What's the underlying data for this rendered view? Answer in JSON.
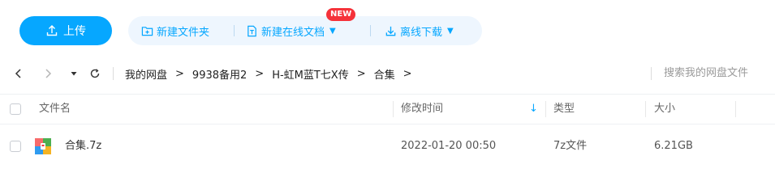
{
  "toolbar": {
    "upload_label": "上传",
    "new_folder_label": "新建文件夹",
    "new_online_doc_label": "新建在线文档",
    "new_badge": "NEW",
    "offline_download_label": "离线下载"
  },
  "navbar": {
    "breadcrumbs": [
      "我的网盘",
      "9938备用2",
      "H-虹M蓝T七X传",
      "合集"
    ],
    "search_placeholder": "搜索我的网盘文件"
  },
  "table": {
    "columns": {
      "name": "文件名",
      "modified": "修改时间",
      "type": "类型",
      "size": "大小"
    },
    "sort_indicator": "↓",
    "rows": [
      {
        "name": "合集.7z",
        "modified": "2022-01-20 00:50",
        "type": "7z文件",
        "size": "6.21GB",
        "icon": "archive-7z-icon"
      }
    ]
  },
  "colors": {
    "accent": "#06a7ff",
    "pill_bg": "#eef6fe",
    "badge": "#f5323a"
  }
}
